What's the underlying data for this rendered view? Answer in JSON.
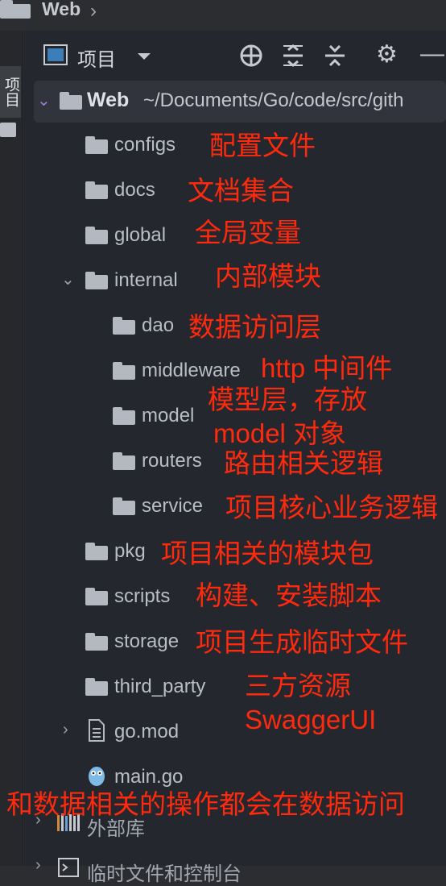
{
  "breadcrumb": {
    "label": "Web"
  },
  "tool_strip": {
    "project_tab": "项目"
  },
  "toolbar": {
    "title": "项目"
  },
  "tree": {
    "root": {
      "name": "Web",
      "path": "~/Documents/Go/code/src/gith"
    },
    "items": [
      {
        "name": "configs"
      },
      {
        "name": "docs"
      },
      {
        "name": "global"
      },
      {
        "name": "internal"
      },
      {
        "name": "dao"
      },
      {
        "name": "middleware"
      },
      {
        "name": "model"
      },
      {
        "name": "routers"
      },
      {
        "name": "service"
      },
      {
        "name": "pkg"
      },
      {
        "name": "scripts"
      },
      {
        "name": "storage"
      },
      {
        "name": "third_party"
      },
      {
        "name": "go.mod"
      },
      {
        "name": "main.go"
      }
    ],
    "external_libs": "外部库",
    "scratches": "临时文件和控制台"
  },
  "annotations": [
    "配置文件",
    "文档集合",
    "全局变量",
    "内部模块",
    "数据访问层",
    "http 中间件",
    "模型层，存放",
    "model 对象",
    "路由相关逻辑",
    "项目核心业务逻辑",
    "项目相关的模块包",
    "构建、安装脚本",
    "项目生成临时文件",
    "三方资源",
    "SwaggerUI",
    "和数据相关的操作都会在数据访问"
  ],
  "colors": {
    "annotation": "#ff2a0d",
    "panel_bg": "#25272e",
    "folder": "#b4b8c0"
  }
}
